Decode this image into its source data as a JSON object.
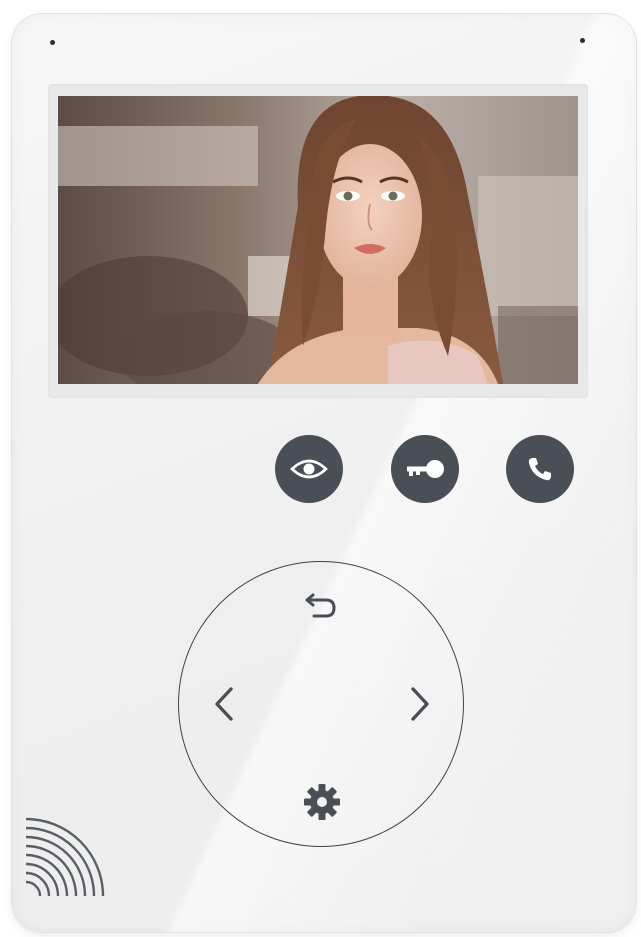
{
  "device": {
    "body_color": "#f2f2f2",
    "button_color": "#4a4f57",
    "ring_color": "#3f444b"
  },
  "screen": {
    "content": "live-video-feed"
  },
  "function_buttons": [
    {
      "name": "monitor",
      "icon": "eye-icon"
    },
    {
      "name": "unlock",
      "icon": "key-icon"
    },
    {
      "name": "call",
      "icon": "phone-icon"
    }
  ],
  "navigation": [
    {
      "name": "back",
      "icon": "return-arrow-icon"
    },
    {
      "name": "left",
      "icon": "chevron-left-icon"
    },
    {
      "name": "right",
      "icon": "chevron-right-icon"
    },
    {
      "name": "settings",
      "icon": "gear-icon"
    }
  ],
  "speaker": {
    "icon": "speaker-grille-icon"
  }
}
